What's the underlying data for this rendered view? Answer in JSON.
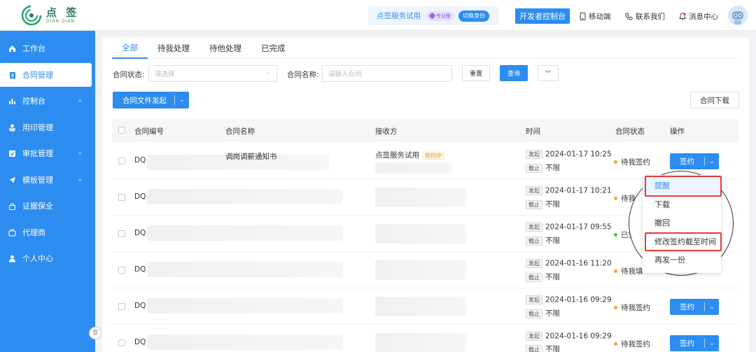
{
  "header": {
    "logo_cn": "点 签",
    "logo_en": "DIAN QIAN",
    "trial_text": "点签服务试用",
    "pro_badge": "专业版",
    "switch_identity": "切换身份",
    "developer_console": "开发者控制台",
    "mobile": "移动端",
    "contact": "联系我们",
    "messages": "消息中心"
  },
  "sidebar": {
    "items": [
      {
        "label": "工作台",
        "icon": "home-icon"
      },
      {
        "label": "合同管理",
        "icon": "document-icon"
      },
      {
        "label": "控制台",
        "icon": "bar-chart-icon"
      },
      {
        "label": "用印管理",
        "icon": "stamp-icon"
      },
      {
        "label": "审批管理",
        "icon": "approval-icon"
      },
      {
        "label": "模板管理",
        "icon": "send-icon"
      },
      {
        "label": "证据保全",
        "icon": "lock-icon"
      },
      {
        "label": "代理商",
        "icon": "briefcase-icon"
      },
      {
        "label": "个人中心",
        "icon": "user-icon"
      }
    ]
  },
  "tabs": [
    "全部",
    "待我处理",
    "待他处理",
    "已完成"
  ],
  "filters": {
    "status_label": "合同状态:",
    "status_placeholder": "请选择",
    "name_label": "合同名称:",
    "name_placeholder": "请输入合同",
    "reset": "重置",
    "query": "查询"
  },
  "actions": {
    "initiate": "合同文件发起",
    "download": "合同下载"
  },
  "table": {
    "columns": [
      "合同编号",
      "合同名称",
      "接收方",
      "时间",
      "合同状态",
      "操作"
    ],
    "start_tag": "发起",
    "end_tag": "截止",
    "no_limit": "不限",
    "sign": "签约",
    "rows": [
      {
        "id": "DQ",
        "name": "调岗调薪通知书",
        "receiver": "点签服务试用",
        "receiver_badge": "签约中",
        "start": "2024-01-17 10:25",
        "status": "待我签约",
        "status_color": "#f5a623"
      },
      {
        "id": "DQ",
        "name": "",
        "receiver": "",
        "receiver_badge": "",
        "start": "2024-01-17 10:21",
        "status": "待我填",
        "status_color": "#f5a623"
      },
      {
        "id": "DQ",
        "name": "",
        "receiver": "",
        "receiver_badge": "",
        "start": "2024-01-17 09:55",
        "status": "已完成",
        "status_color": "#52c41a"
      },
      {
        "id": "DQ",
        "name": "",
        "receiver": "",
        "receiver_badge": "",
        "start": "2024-01-16 11:20",
        "status": "待我填",
        "status_color": "#f5a623"
      },
      {
        "id": "DQ",
        "name": "",
        "receiver": "",
        "receiver_badge": "",
        "start": "2024-01-16 09:29",
        "status": "待我签约",
        "status_color": "#f5a623"
      },
      {
        "id": "DQ",
        "name": "",
        "receiver": "",
        "receiver_badge": "",
        "start": "2024-01-16 09:29",
        "status": "待我签约",
        "status_color": "#f5a623"
      }
    ]
  },
  "dropdown": {
    "items": [
      "提醒",
      "下载",
      "撤回",
      "修改签约截至时间",
      "再发一份"
    ]
  }
}
